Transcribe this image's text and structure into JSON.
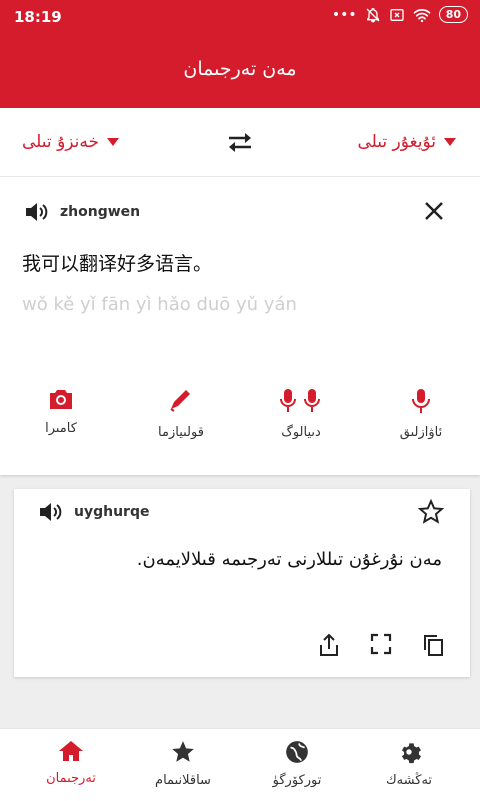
{
  "status": {
    "time": "18:19",
    "battery": "80"
  },
  "app": {
    "title": "مەن تەرجىمان"
  },
  "languages": {
    "source": "خەنزۇ تىلى",
    "target": "ئۇيغۇر تىلى"
  },
  "source_card": {
    "lang_code": "zhongwen",
    "text": "我可以翻译好多语言。",
    "pinyin": "wǒ kě yǐ fān yì hǎo duō yǔ yán",
    "tools": [
      "كامىرا",
      "قولىيازما",
      "دىيالوگ",
      "ئاۋازلىق"
    ]
  },
  "translation_card": {
    "lang_code": "uyghurqe",
    "text": "مەن نۇرغۇن تىللارنى تەرجىمە قىلالايمەن."
  },
  "nav": [
    "تەرجىمان",
    "ساقلانىمام",
    "توركۆرگۈ",
    "تەڭشەك"
  ],
  "colors": {
    "accent": "#d41c2c"
  }
}
